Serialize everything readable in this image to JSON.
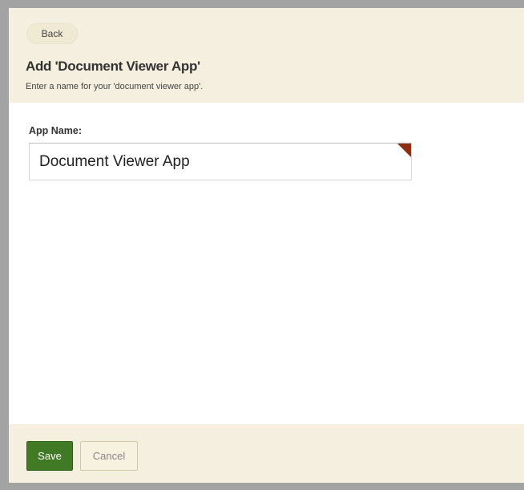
{
  "header": {
    "back_label": "Back",
    "title": "Add 'Document Viewer App'",
    "subtitle": "Enter a name for your 'document viewer app'."
  },
  "form": {
    "app_name_label": "App Name:",
    "app_name_value": "Document Viewer App"
  },
  "footer": {
    "save_label": "Save",
    "cancel_label": "Cancel"
  },
  "colors": {
    "header_bg": "#f4efdf",
    "save_bg": "#417a25",
    "required_marker": "#8b2e12",
    "frame_border": "#a3a3a3"
  }
}
